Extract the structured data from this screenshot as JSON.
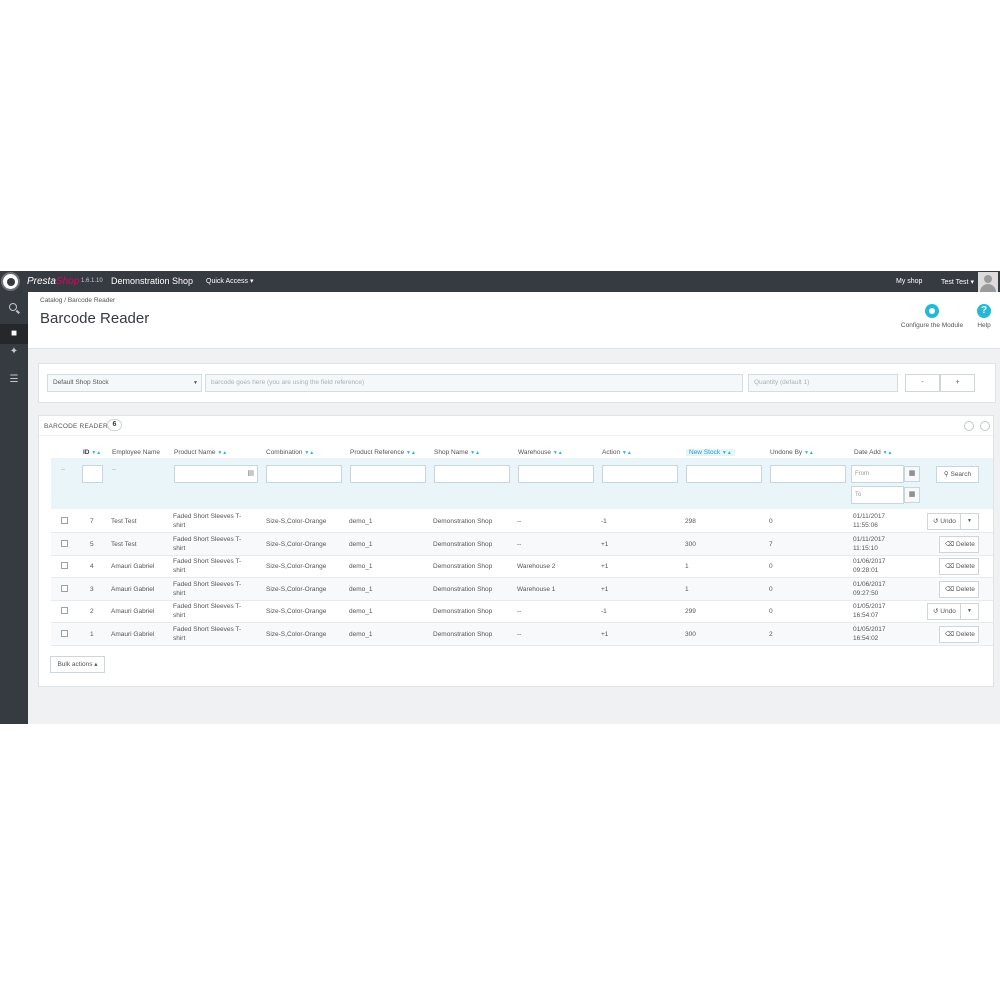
{
  "topbar": {
    "brand_a": "Presta",
    "brand_b": "Shop",
    "version": "1.6.1.10",
    "shop_name": "Demonstration Shop",
    "quick_access": "Quick Access ▾",
    "my_shop": "My shop",
    "user": "Test Test ▾"
  },
  "sidebar": {
    "icons": [
      "search-icon",
      "book-icon",
      "puzzle-icon",
      "menu-icon"
    ]
  },
  "header": {
    "breadcrumb": "Catalog  /  Barcode Reader",
    "title": "Barcode Reader",
    "configure_label": "Configure the Module",
    "help_label": "Help"
  },
  "reader": {
    "stock_select": "Default Shop Stock",
    "barcode_placeholder": "barcode goes here (you are using the field reference)",
    "quantity_placeholder": "Quantity (default 1)",
    "minus_label": "-",
    "plus_label": "+"
  },
  "list": {
    "title": "BARCODE READER",
    "count": "6",
    "columns": [
      "ID",
      "Employee Name",
      "Product Name",
      "Combination",
      "Product Reference",
      "Shop Name",
      "Warehouse",
      "Action",
      "New Stock",
      "Undone By",
      "Date Add"
    ],
    "filter": {
      "id_placeholder": "--",
      "employee_value": "--",
      "date_from": "From",
      "date_to": "To",
      "search_label": "Search"
    },
    "rows": [
      {
        "id": "7",
        "employee": "Test Test",
        "product_line1": "Faded Short Sleeves T-",
        "product_line2": "shirt",
        "combination": "Size-S,Color-Orange",
        "reference": "demo_1",
        "shop": "Demonstration Shop",
        "warehouse": "--",
        "action": "-1",
        "new_stock": "298",
        "undone_by": "0",
        "date1": "01/11/2017",
        "date2": "11:55:06",
        "button": "Undo"
      },
      {
        "id": "5",
        "employee": "Test Test",
        "product_line1": "Faded Short Sleeves T-",
        "product_line2": "shirt",
        "combination": "Size-S,Color-Orange",
        "reference": "demo_1",
        "shop": "Demonstration Shop",
        "warehouse": "--",
        "action": "+1",
        "new_stock": "300",
        "undone_by": "7",
        "date1": "01/11/2017",
        "date2": "11:15:10",
        "button": "Delete"
      },
      {
        "id": "4",
        "employee": "Amauri Gabriel",
        "product_line1": "Faded Short Sleeves T-",
        "product_line2": "shirt",
        "combination": "Size-S,Color-Orange",
        "reference": "demo_1",
        "shop": "Demonstration Shop",
        "warehouse": "Warehouse 2",
        "action": "+1",
        "new_stock": "1",
        "undone_by": "0",
        "date1": "01/06/2017",
        "date2": "09:28:01",
        "button": "Delete"
      },
      {
        "id": "3",
        "employee": "Amauri Gabriel",
        "product_line1": "Faded Short Sleeves T-",
        "product_line2": "shirt",
        "combination": "Size-S,Color-Orange",
        "reference": "demo_1",
        "shop": "Demonstration Shop",
        "warehouse": "Warehouse 1",
        "action": "+1",
        "new_stock": "1",
        "undone_by": "0",
        "date1": "01/06/2017",
        "date2": "09:27:50",
        "button": "Delete"
      },
      {
        "id": "2",
        "employee": "Amauri Gabriel",
        "product_line1": "Faded Short Sleeves T-",
        "product_line2": "shirt",
        "combination": "Size-S,Color-Orange",
        "reference": "demo_1",
        "shop": "Demonstration Shop",
        "warehouse": "--",
        "action": "-1",
        "new_stock": "299",
        "undone_by": "0",
        "date1": "01/05/2017",
        "date2": "16:54:07",
        "button": "Undo"
      },
      {
        "id": "1",
        "employee": "Amauri Gabriel",
        "product_line1": "Faded Short Sleeves T-",
        "product_line2": "shirt",
        "combination": "Size-S,Color-Orange",
        "reference": "demo_1",
        "shop": "Demonstration Shop",
        "warehouse": "--",
        "action": "+1",
        "new_stock": "300",
        "undone_by": "2",
        "date1": "01/05/2017",
        "date2": "16:54:02",
        "button": "Delete"
      }
    ],
    "bulk_label": "Bulk actions ▴"
  },
  "colors": {
    "topbar": "#363a41",
    "accent": "#25b9d7",
    "brand_pink": "#df0067"
  }
}
